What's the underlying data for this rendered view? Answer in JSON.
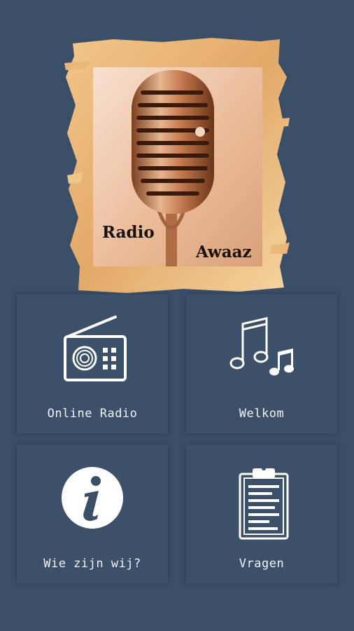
{
  "logo": {
    "line1": "Radio",
    "line2": "Awaaz"
  },
  "menu": {
    "items": [
      {
        "label": "Online Radio",
        "icon": "radio-icon"
      },
      {
        "label": "Welkom",
        "icon": "music-notes-icon"
      },
      {
        "label": "Wie zijn wij?",
        "icon": "info-icon"
      },
      {
        "label": "Vragen",
        "icon": "clipboard-icon"
      }
    ]
  },
  "colors": {
    "background": "#3a4e68",
    "tile": "#3c506a",
    "icon": "#ffffff",
    "brush": "#e8b472"
  }
}
